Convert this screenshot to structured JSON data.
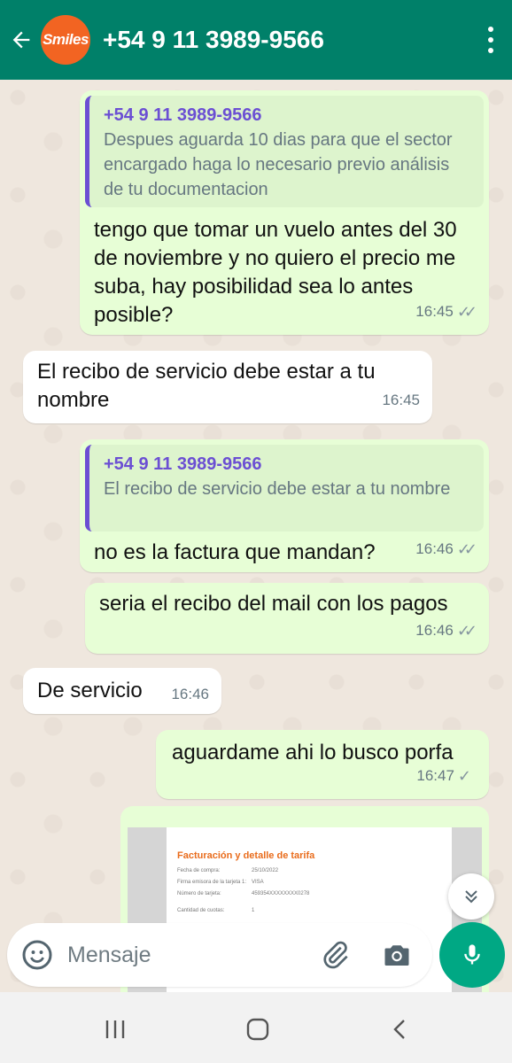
{
  "header": {
    "contact": "+54 9 11 3989-9566",
    "avatar_text": "Smiles",
    "color": "#008069"
  },
  "messages": [
    {
      "dir": "out",
      "quote_name": "+54 9 11 3989-9566",
      "quote_text": "Despues aguarda 10 dias para que el sector encargado haga lo necesario previo análisis de tu documentacion",
      "text": "tengo que tomar un vuelo antes del 30 de noviembre y no quiero el precio me suba, hay posibilidad sea lo antes posible?",
      "time": "16:45",
      "ticks": "read"
    },
    {
      "dir": "in",
      "text": "El recibo de servicio debe estar a tu nombre",
      "time": "16:45"
    },
    {
      "dir": "out",
      "quote_name": "+54 9 11 3989-9566",
      "quote_text": "El recibo de servicio debe estar a tu nombre",
      "text": "no es la factura que mandan?",
      "time": "16:46",
      "ticks": "read"
    },
    {
      "dir": "out",
      "text": "seria el recibo del mail con los pagos",
      "time": "16:46",
      "ticks": "read"
    },
    {
      "dir": "in",
      "text": "De servicio",
      "time": "16:46"
    },
    {
      "dir": "out",
      "text": "aguardame ahi lo busco porfa",
      "time": "16:47",
      "ticks": "sent"
    }
  ],
  "document": {
    "title": "Facturación y detalle de tarifa",
    "rows": [
      {
        "k": "Fecha de compra:",
        "v": "25/10/2022"
      },
      {
        "k": "Firma emisora de la tarjeta 1:",
        "v": "VISA"
      },
      {
        "k": "Número de tarjeta:",
        "v": "459354XXXXXXXX0278"
      },
      {
        "k": "Cantidad de cuotas:",
        "v": "1"
      }
    ]
  },
  "input": {
    "placeholder": "Mensaje"
  },
  "colors": {
    "outgoing": "#e7fed6",
    "incoming": "#ffffff",
    "accent": "#00a884",
    "quote": "#6b4fd3"
  }
}
